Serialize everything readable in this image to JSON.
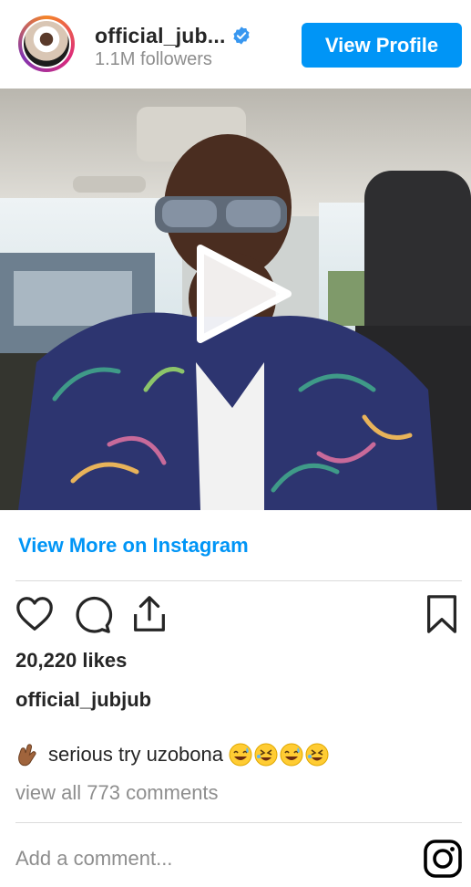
{
  "header": {
    "username": "official_jub...",
    "followers": "1.1M followers",
    "view_profile_label": "View Profile",
    "verified_icon": "verified-badge-icon"
  },
  "media": {
    "type": "video",
    "play_icon": "play-icon"
  },
  "links": {
    "view_more": "View More on Instagram"
  },
  "actions": {
    "like_icon": "heart-icon",
    "comment_icon": "comment-icon",
    "share_icon": "share-icon",
    "save_icon": "bookmark-icon"
  },
  "post": {
    "likes": "20,220 likes",
    "username": "official_jubjub",
    "caption_prefix_icon": "crossed-fingers-emoji",
    "caption_text": "serious try uzobona",
    "caption_suffix_icons": [
      "grinning-sweat-emoji",
      "rofl-emoji",
      "grinning-sweat-emoji",
      "rofl-emoji"
    ],
    "view_comments": "view all 773 comments"
  },
  "footer": {
    "add_comment_placeholder": "Add a comment...",
    "logo_icon": "instagram-logo-icon"
  },
  "colors": {
    "accent": "#0095f6",
    "text": "#262626",
    "muted": "#8e8e8e",
    "divider": "#dbdbdb"
  }
}
